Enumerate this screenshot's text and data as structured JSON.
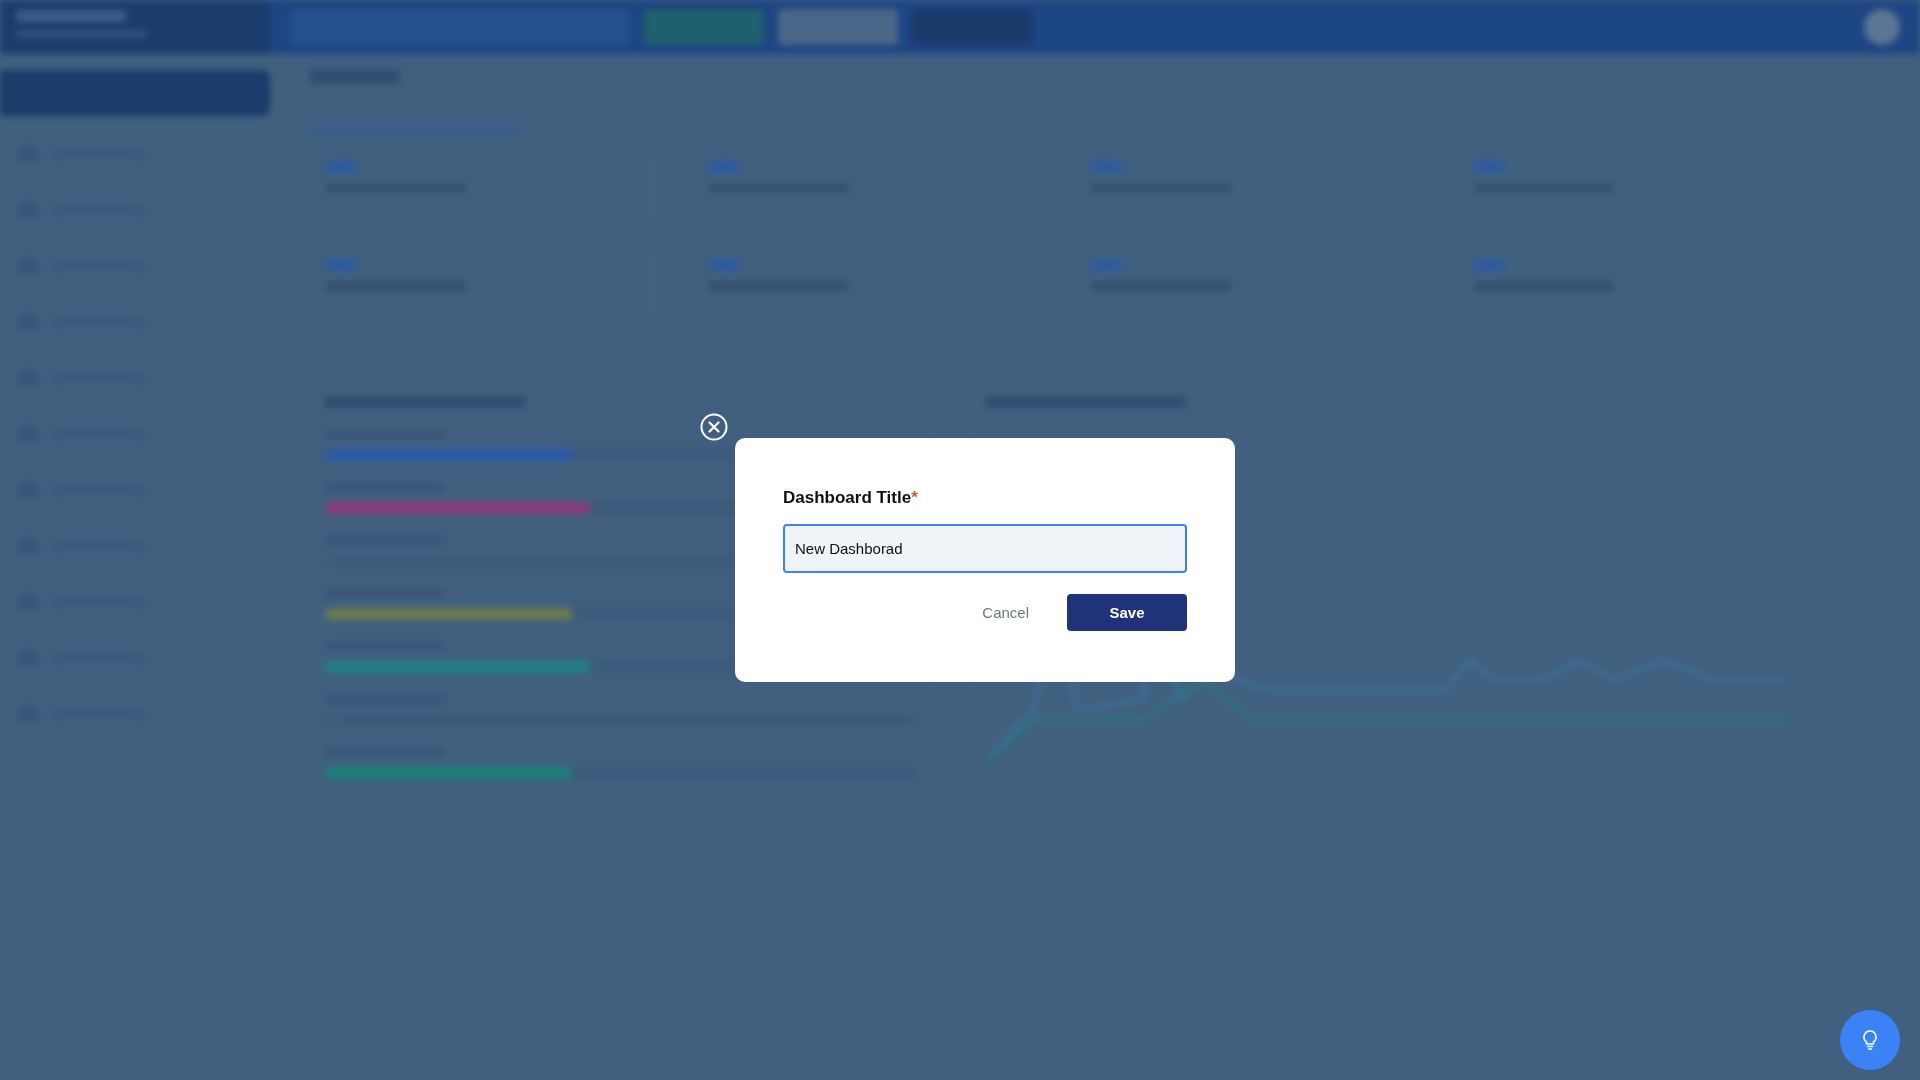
{
  "dialog": {
    "field_label": "Dashboard Title",
    "required_mark": "*",
    "field": {
      "value": "New Dashborad",
      "focused": true
    },
    "buttons": [
      {
        "kind": "secondary",
        "label": "Cancel"
      },
      {
        "kind": "primary",
        "label": "Save"
      }
    ]
  }
}
